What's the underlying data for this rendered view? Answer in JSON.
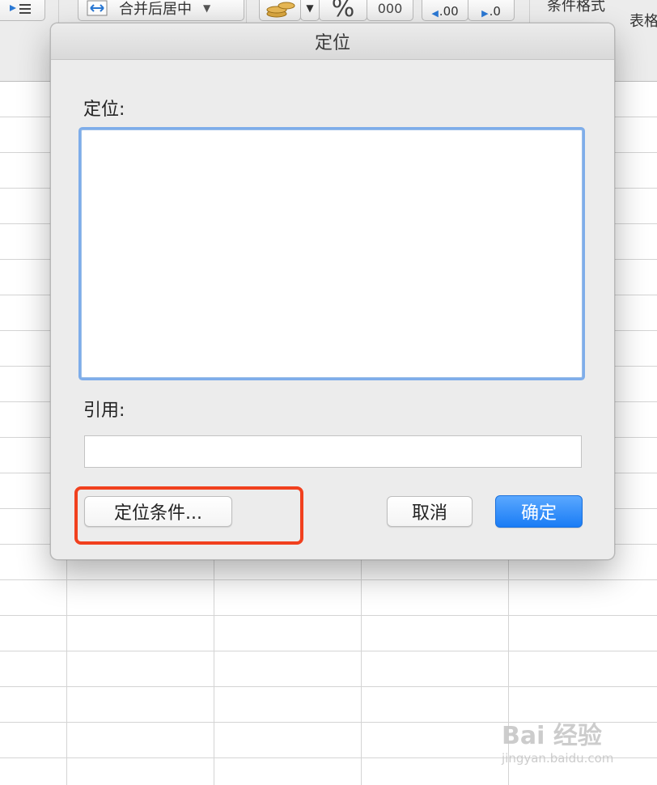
{
  "toolbar": {
    "merge_center_label": "合并后居中",
    "percent_label": "%",
    "thousands_label": "000",
    "increase_decimal_label": ".00",
    "decrease_decimal_label": ".0",
    "conditional_format_label": "条件格式",
    "table_format_label": "表格"
  },
  "dialog": {
    "title": "定位",
    "locate_label": "定位:",
    "reference_label": "引用:",
    "reference_value": "",
    "special_button": "定位条件...",
    "cancel_button": "取消",
    "ok_button": "确定"
  },
  "watermark": {
    "main": "Bai 经验",
    "sub": "jingyan.baidu.com"
  },
  "colors": {
    "primary_button": "#1a7cf5",
    "highlight_border": "#f1401e",
    "list_focus_ring": "#7eadea"
  }
}
